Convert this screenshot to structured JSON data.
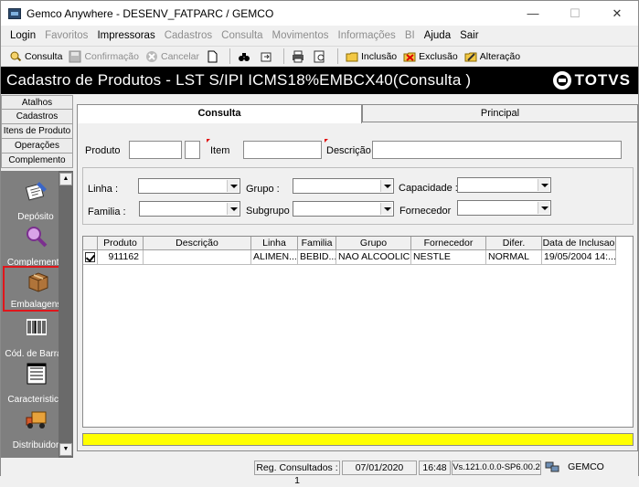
{
  "window": {
    "title": "Gemco Anywhere - DESENV_FATPARC / GEMCO",
    "minimize": "—",
    "maximize": "☐",
    "close": "✕"
  },
  "menu": {
    "items": [
      {
        "label": "Login",
        "enabled": true
      },
      {
        "label": "Favoritos",
        "enabled": false
      },
      {
        "label": "Impressoras",
        "enabled": true
      },
      {
        "label": "Cadastros",
        "enabled": false
      },
      {
        "label": "Consulta",
        "enabled": false
      },
      {
        "label": "Movimentos",
        "enabled": false
      },
      {
        "label": "Informações",
        "enabled": false
      },
      {
        "label": "BI",
        "enabled": false
      },
      {
        "label": "Ajuda",
        "enabled": true
      },
      {
        "label": "Sair",
        "enabled": true
      }
    ]
  },
  "toolbar": {
    "consulta": "Consulta",
    "confirmacao": "Confirmação",
    "cancelar": "Cancelar",
    "inclusao": "Inclusão",
    "exclusao": "Exclusão",
    "alteracao": "Alteração"
  },
  "header": {
    "title": "Cadastro de Produtos  - LST S/IPI  ICMS18%EMBCX40(Consulta )",
    "logo": "TOTVS"
  },
  "left_tabs": [
    "Atalhos",
    "Cadastros",
    "Itens de Produto",
    "Operações",
    "Complemento"
  ],
  "left_icons": [
    {
      "label": "Depósito",
      "icon": "deposit-icon"
    },
    {
      "label": "Complemento",
      "icon": "magnifier-icon"
    },
    {
      "label": "Embalagens",
      "icon": "box-icon",
      "selected": true
    },
    {
      "label": "Cód. de Barras",
      "icon": "barcode-icon"
    },
    {
      "label": "Caracteristica",
      "icon": "list-icon"
    },
    {
      "label": "Distribuidor",
      "icon": "truck-icon"
    }
  ],
  "tabs": {
    "consulta": "Consulta",
    "principal": "Principal"
  },
  "search": {
    "produto_label": "Produto",
    "produto_value": "",
    "produto_digit": "",
    "item_label": "Item",
    "item_value": "",
    "descricao_label": "Descrição",
    "descricao_value": ""
  },
  "filters": {
    "linha_label": "Linha :",
    "grupo_label": "Grupo :",
    "capacidade_label": "Capacidade :",
    "familia_label": "Familia :",
    "subgrupo_label": "Subgrupo :",
    "fornecedor_label": "Fornecedor",
    "linha_value": "",
    "grupo_value": "",
    "capacidade_value": "",
    "familia_value": "",
    "subgrupo_value": "",
    "fornecedor_value": ""
  },
  "grid": {
    "columns": [
      "Produto",
      "Descrição",
      "Linha",
      "Familia",
      "Grupo",
      "Fornecedor",
      "Difer.",
      "Data de Inclusao"
    ],
    "rows": [
      [
        "911162",
        "",
        "ALIMEN...",
        "BEBID...",
        "NAO ALCOOLIC...",
        "NESTLE",
        "NORMAL",
        "19/05/2004 14:..."
      ]
    ]
  },
  "status": {
    "reg_consultados": "Reg. Consultados : 1",
    "date": "07/01/2020",
    "time": "16:48",
    "version": "Vs.121.0.0.0-SP6.00.2",
    "company": "GEMCO"
  },
  "colors": {
    "header_bg": "#000000",
    "selected_border": "#e0161b",
    "yellow_bar": "#ffff00",
    "left_icon_panel": "#7f7f7f"
  }
}
